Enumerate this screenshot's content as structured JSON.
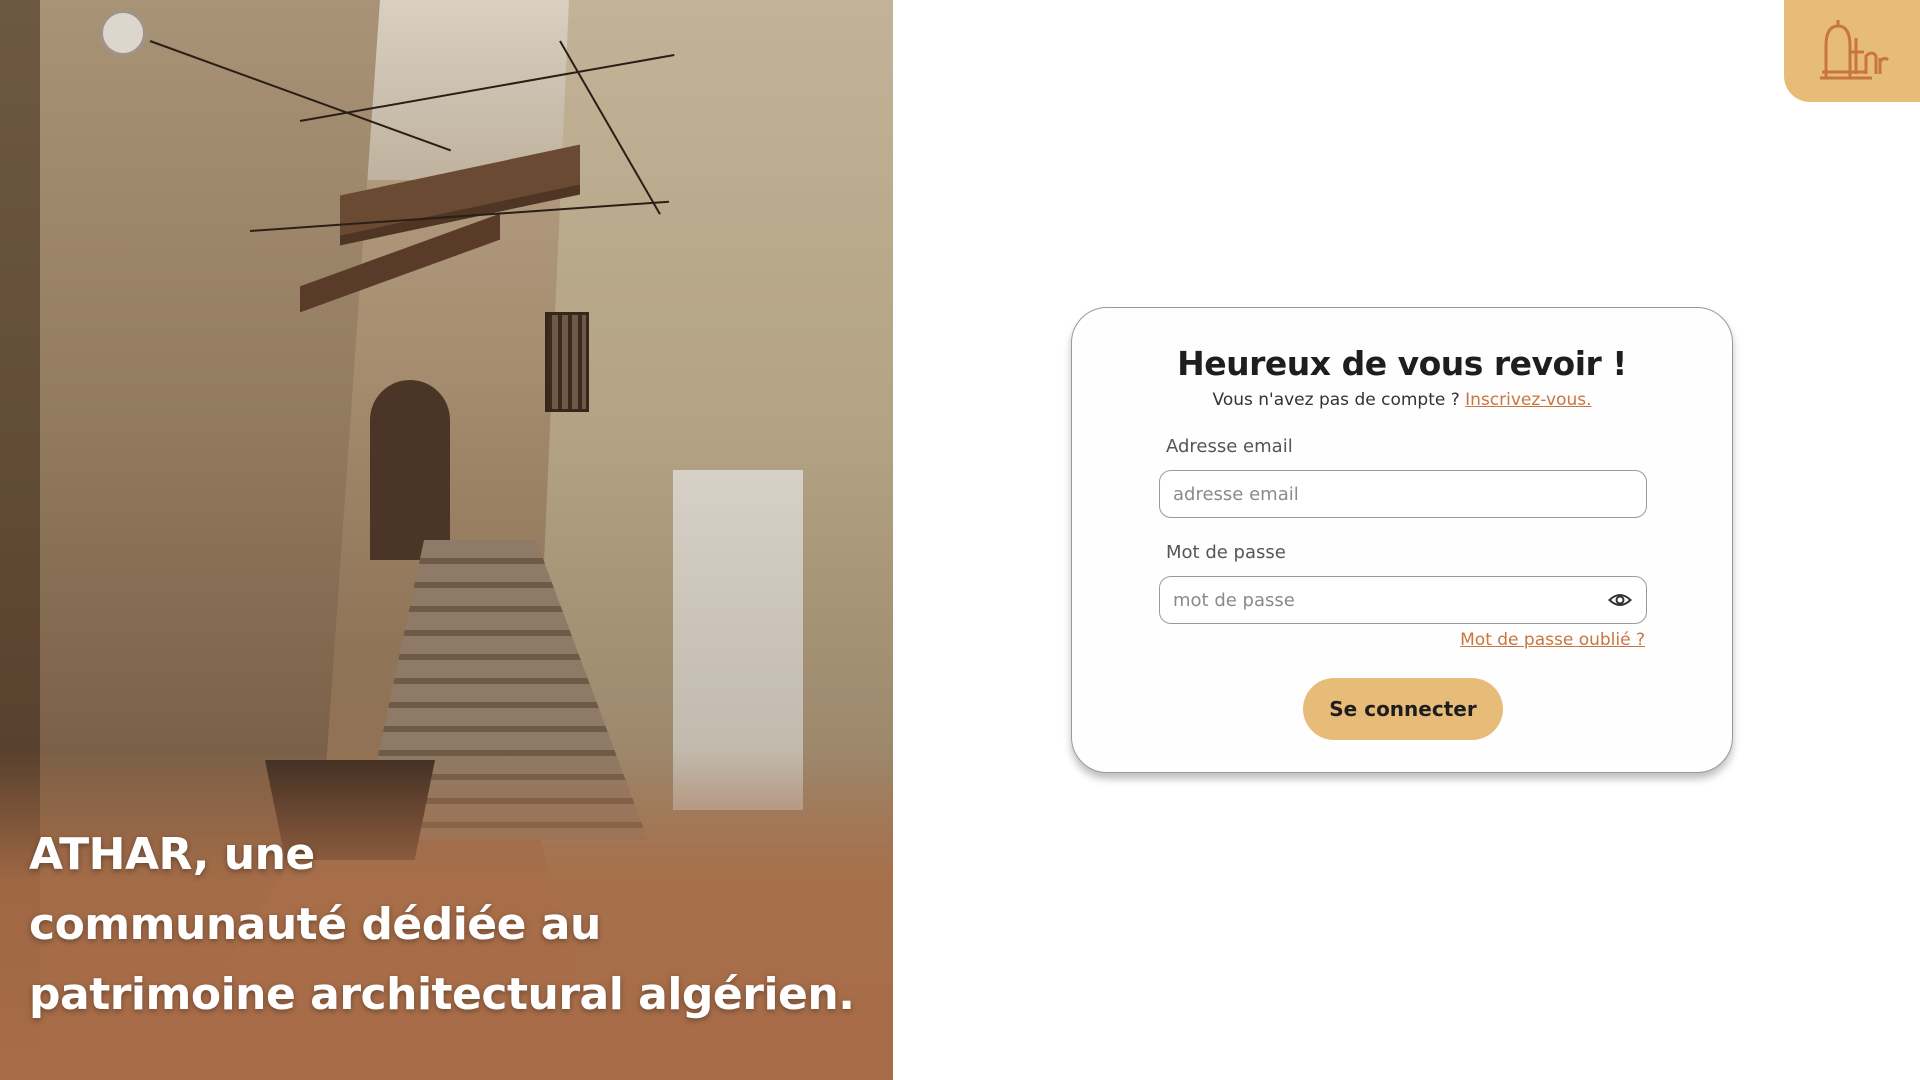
{
  "hero": {
    "caption_line1": "ATHAR, une",
    "caption_line2": "communauté dédiée au",
    "caption_line3": "patrimoine architectural algérien."
  },
  "logo": {
    "icon": "athar-logo-icon",
    "badge_color": "#e7bb78",
    "mark_color": "#c8753e"
  },
  "login": {
    "title": "Heureux de vous revoir !",
    "no_account_text": "Vous n'avez pas de compte ?",
    "signup_link": "Inscrivez-vous.",
    "email_label": "Adresse email",
    "email_placeholder": "adresse email",
    "email_value": "",
    "password_label": "Mot de passe",
    "password_placeholder": "mot de passe",
    "password_value": "",
    "password_toggle_icon": "eye-icon",
    "forgot_link": "Mot de passe oublié ?",
    "submit_label": "Se connecter"
  },
  "colors": {
    "accent": "#e7bb78",
    "link": "#c8753e",
    "text": "#1e1e1e"
  }
}
